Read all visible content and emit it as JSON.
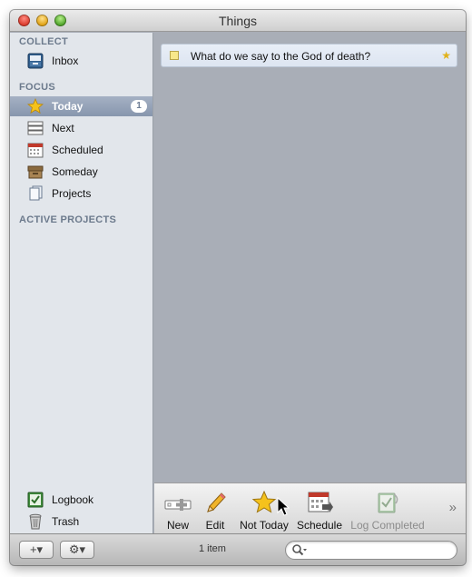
{
  "window": {
    "title": "Things"
  },
  "sidebar": {
    "collect_header": "COLLECT",
    "focus_header": "FOCUS",
    "active_projects_header": "ACTIVE PROJECTS",
    "inbox": {
      "label": "Inbox",
      "icon": "inbox-icon"
    },
    "today": {
      "label": "Today",
      "icon": "star-icon",
      "badge": "1"
    },
    "next": {
      "label": "Next",
      "icon": "next-icon"
    },
    "scheduled": {
      "label": "Scheduled",
      "icon": "calendar-icon"
    },
    "someday": {
      "label": "Someday",
      "icon": "box-icon"
    },
    "projects": {
      "label": "Projects",
      "icon": "projects-icon"
    },
    "logbook": {
      "label": "Logbook",
      "icon": "logbook-icon"
    },
    "trash": {
      "label": "Trash",
      "icon": "trash-icon"
    }
  },
  "tasks": [
    {
      "title": "What do we say to the God of death?",
      "starred": true
    }
  ],
  "toolbar": {
    "new_label": "New",
    "edit_label": "Edit",
    "not_today_label": "Not Today",
    "schedule_label": "Schedule",
    "log_completed_label": "Log Completed",
    "overflow": "»"
  },
  "bottom": {
    "add_button": "+▾",
    "gear_button": "⚙▾",
    "status": "1 item",
    "search_placeholder": ""
  },
  "colors": {
    "selection": "#8796ad",
    "content_bg": "#a9aeb7",
    "sidebar_bg": "#e2e6eb",
    "star": "#e1b21a"
  }
}
